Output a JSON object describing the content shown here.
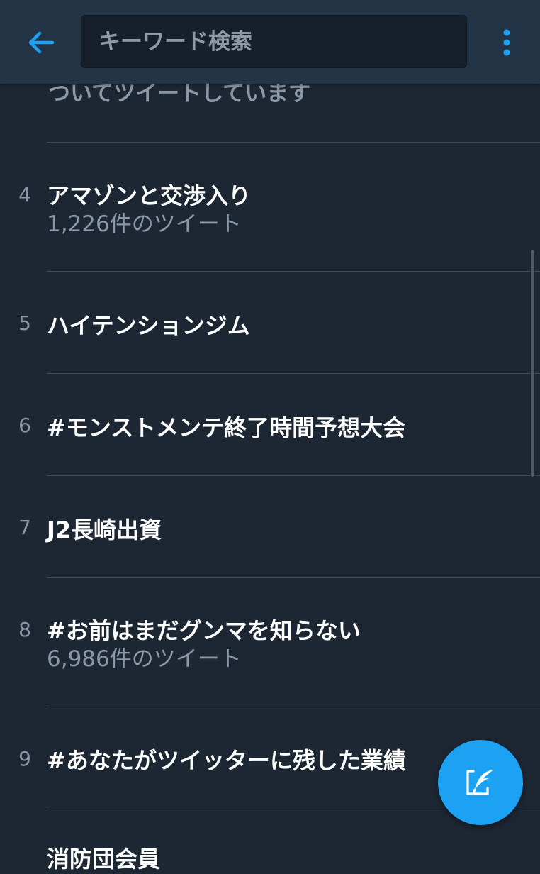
{
  "header": {
    "back_icon": "arrow-left-icon",
    "search_placeholder": "キーワード検索",
    "more_icon": "more-vertical-icon"
  },
  "previous_tail": "ついてツイートしています",
  "trends": [
    {
      "rank": "4",
      "title": "アマゾンと交渉入り",
      "count": "1,226件のツイート"
    },
    {
      "rank": "5",
      "title": "ハイテンションジム",
      "count": ""
    },
    {
      "rank": "6",
      "title": "#モンストメンテ終了時間予想大会",
      "count": ""
    },
    {
      "rank": "7",
      "title": "J2長崎出資",
      "count": ""
    },
    {
      "rank": "8",
      "title": "#お前はまだグンマを知らない",
      "count": "6,986件のツイート"
    },
    {
      "rank": "9",
      "title": "#あなたがツイッターに残した業績",
      "count": ""
    }
  ],
  "next_cut_title": "消防団会員",
  "fab": {
    "icon": "compose-tweet-icon"
  },
  "colors": {
    "background": "#1c2733",
    "header": "#243447",
    "accent": "#1da1f2",
    "secondary_text": "#8b98a5"
  }
}
